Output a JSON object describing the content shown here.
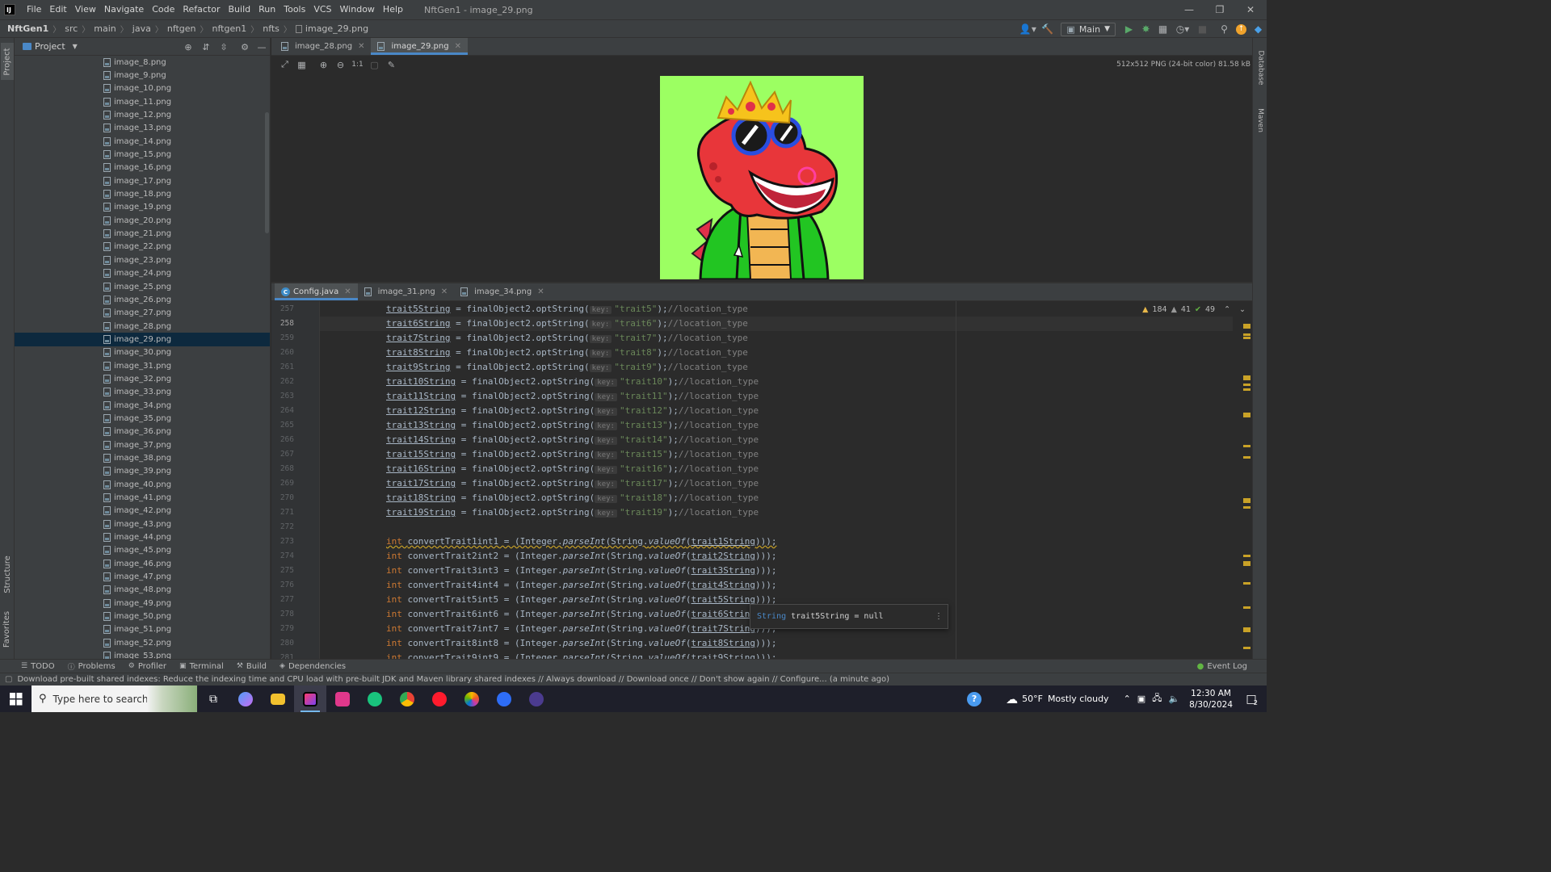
{
  "menu": {
    "items": [
      "File",
      "Edit",
      "View",
      "Navigate",
      "Code",
      "Refactor",
      "Build",
      "Run",
      "Tools",
      "VCS",
      "Window",
      "Help"
    ],
    "window_title": "NftGen1 - image_29.png"
  },
  "breadcrumbs": [
    "NftGen1",
    "src",
    "main",
    "java",
    "nftgen",
    "nftgen1",
    "nfts",
    "image_29.png"
  ],
  "run_config": "Main",
  "project_panel": {
    "title": "Project",
    "files": [
      "image_8.png",
      "image_9.png",
      "image_10.png",
      "image_11.png",
      "image_12.png",
      "image_13.png",
      "image_14.png",
      "image_15.png",
      "image_16.png",
      "image_17.png",
      "image_18.png",
      "image_19.png",
      "image_20.png",
      "image_21.png",
      "image_22.png",
      "image_23.png",
      "image_24.png",
      "image_25.png",
      "image_26.png",
      "image_27.png",
      "image_28.png",
      "image_29.png",
      "image_30.png",
      "image_31.png",
      "image_32.png",
      "image_33.png",
      "image_34.png",
      "image_35.png",
      "image_36.png",
      "image_37.png",
      "image_38.png",
      "image_39.png",
      "image_40.png",
      "image_41.png",
      "image_42.png",
      "image_43.png",
      "image_44.png",
      "image_45.png",
      "image_46.png",
      "image_47.png",
      "image_48.png",
      "image_49.png",
      "image_50.png",
      "image_51.png",
      "image_52.png",
      "image_53.png"
    ],
    "selected": "image_29.png"
  },
  "left_strip": {
    "project": "Project",
    "structure": "Structure",
    "favorites": "Favorites"
  },
  "right_strip": {
    "database": "Database",
    "maven": "Maven"
  },
  "top_tabs": [
    {
      "label": "image_28.png",
      "active": false
    },
    {
      "label": "image_29.png",
      "active": true
    }
  ],
  "image_viewer": {
    "zoom_label": "1:1",
    "info": "512x512 PNG (24-bit color) 81.58 kB"
  },
  "bottom_tabs": [
    {
      "label": "Config.java",
      "active": true
    },
    {
      "label": "image_31.png",
      "active": false
    },
    {
      "label": "image_34.png",
      "active": false
    }
  ],
  "inspections": {
    "warnings": "184",
    "weak_warnings": "41",
    "ok": "49"
  },
  "code": {
    "current_line": 258,
    "opt_lines": [
      {
        "n": 257,
        "field": "trait5String",
        "key": "trait5"
      },
      {
        "n": 258,
        "field": "trait6String",
        "key": "trait6"
      },
      {
        "n": 259,
        "field": "trait7String",
        "key": "trait7"
      },
      {
        "n": 260,
        "field": "trait8String",
        "key": "trait8"
      },
      {
        "n": 261,
        "field": "trait9String",
        "key": "trait9"
      },
      {
        "n": 262,
        "field": "trait10String",
        "key": "trait10"
      },
      {
        "n": 263,
        "field": "trait11String",
        "key": "trait11"
      },
      {
        "n": 264,
        "field": "trait12String",
        "key": "trait12"
      },
      {
        "n": 265,
        "field": "trait13String",
        "key": "trait13"
      },
      {
        "n": 266,
        "field": "trait14String",
        "key": "trait14"
      },
      {
        "n": 267,
        "field": "trait15String",
        "key": "trait15"
      },
      {
        "n": 268,
        "field": "trait16String",
        "key": "trait16"
      },
      {
        "n": 269,
        "field": "trait17String",
        "key": "trait17"
      },
      {
        "n": 270,
        "field": "trait18String",
        "key": "trait18"
      },
      {
        "n": 271,
        "field": "trait19String",
        "key": "trait19"
      }
    ],
    "opt_call": " = finalObject2.optString(",
    "key_hint": "key:",
    "comment": "//location_type",
    "blank_line": 272,
    "int_lines": [
      {
        "n": 273,
        "var": "convertTrait1int1",
        "arg": "trait1String"
      },
      {
        "n": 274,
        "var": "convertTrait2int2",
        "arg": "trait2String"
      },
      {
        "n": 275,
        "var": "convertTrait3int3",
        "arg": "trait3String"
      },
      {
        "n": 276,
        "var": "convertTrait4int4",
        "arg": "trait4String"
      },
      {
        "n": 277,
        "var": "convertTrait5int5",
        "arg": "trait5String"
      },
      {
        "n": 278,
        "var": "convertTrait6int6",
        "arg": "trait6String"
      },
      {
        "n": 279,
        "var": "convertTrait7int7",
        "arg": "trait7String"
      },
      {
        "n": 280,
        "var": "convertTrait8int8",
        "arg": "trait8String"
      },
      {
        "n": 281,
        "var": "convertTrait9int9",
        "arg": "trait9String"
      }
    ]
  },
  "tooltip": {
    "type": "String",
    "text": "trait5String = null"
  },
  "bottom_tools": [
    "TODO",
    "Problems",
    "Profiler",
    "Terminal",
    "Build",
    "Dependencies"
  ],
  "event_log": "Event Log",
  "status_message": "Download pre-built shared indexes: Reduce the indexing time and CPU load with pre-built JDK and Maven library shared indexes // Always download // Download once // Don't show again // Configure... (a minute ago)",
  "taskbar": {
    "search_placeholder": "Type here to search",
    "weather_temp": "50°F",
    "weather_desc": "Mostly cloudy",
    "time": "12:30 AM",
    "date": "8/30/2024",
    "notifications": "2"
  }
}
